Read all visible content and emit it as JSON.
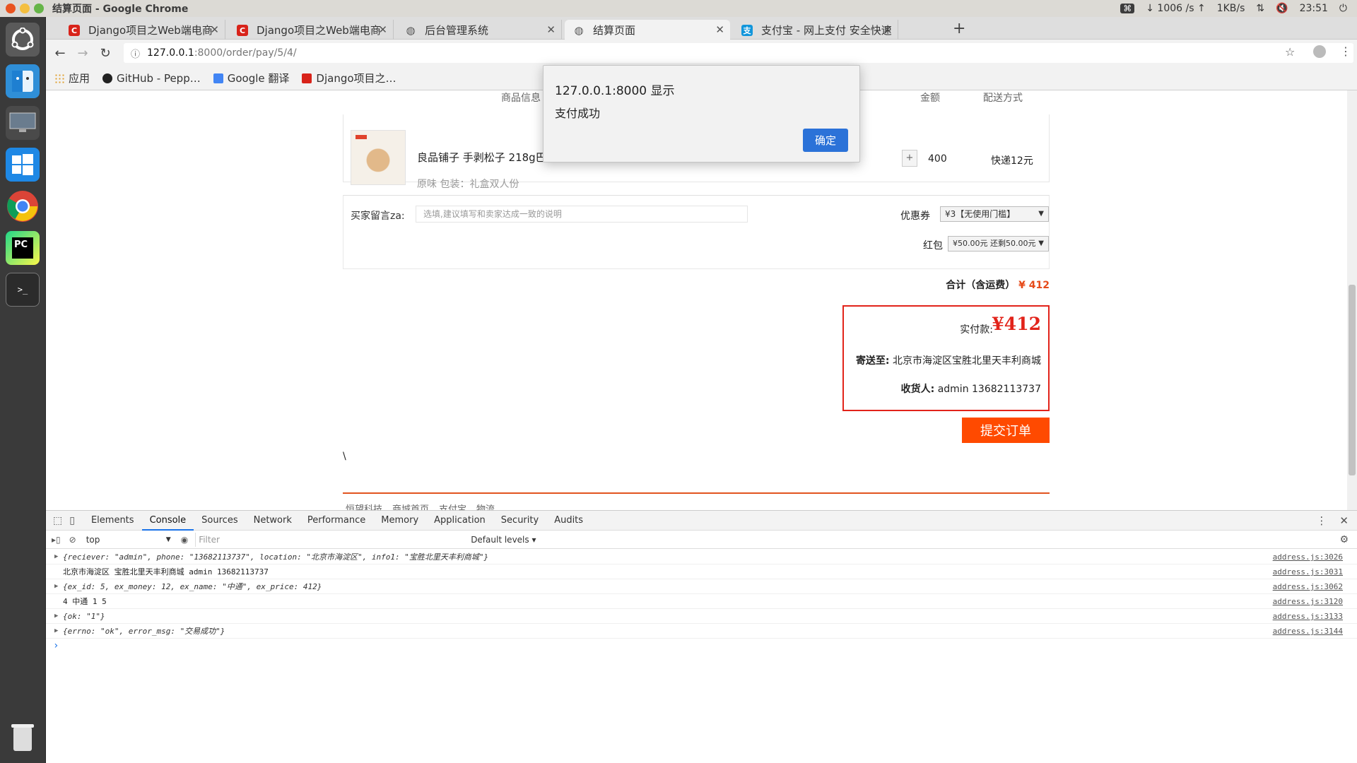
{
  "window": {
    "title": "结算页面 - Google Chrome"
  },
  "tray": {
    "key_icon": "⌘",
    "download": "↓ 1006 /s ↑",
    "upload": "1KB/s",
    "time": "23:51"
  },
  "tabs": [
    {
      "label": "Django项目之Web端电商",
      "favicon": "C",
      "color": "#d8231a"
    },
    {
      "label": "Django项目之Web端电商",
      "favicon": "C",
      "color": "#d8231a"
    },
    {
      "label": "后台管理系统",
      "favicon": "◍",
      "color": "#555555"
    },
    {
      "label": "结算页面",
      "favicon": "◍",
      "color": "#555555"
    },
    {
      "label": "支付宝 - 网上支付 安全快速",
      "favicon": "支",
      "color": "#1296db"
    }
  ],
  "omnibox": {
    "host": "127.0.0.1",
    "path": ":8000/order/pay/5/4/"
  },
  "bookmarks": [
    {
      "label": "应用",
      "color": "#e0a030"
    },
    {
      "label": "GitHub - Pepp…",
      "color": "#222222"
    },
    {
      "label": "Google 翻译",
      "color": "#4285f4"
    },
    {
      "label": "Django项目之…",
      "color": "#d8231a"
    }
  ],
  "order": {
    "headers": {
      "goods": "商品信息",
      "amount": "金额",
      "shipping": "配送方式"
    },
    "item": {
      "name": "良品铺子 手剥松子 218g巴西",
      "spec": "原味 包装：礼盒双人份",
      "price": "400",
      "shipping": "快递12元",
      "qty_plus": "+"
    },
    "note_label": "买家留言za:",
    "note_placeholder": "选填,建议填写和卖家达成一致的说明",
    "coupon_label": "优惠券",
    "coupon_value": "¥3【无使用门槛】",
    "redpack_label": "红包",
    "redpack_value": "¥50.00元 还剩50.00元",
    "total_label": "合计（含运费）",
    "total_amount": "¥ 412",
    "pay_label": "实付款:",
    "pay_amount": "¥412",
    "ship_label": "寄送至:",
    "ship_address": "北京市海淀区宝胜北里天丰利商城",
    "receiver_label": "收货人:",
    "receiver": "admin 13682113737",
    "submit": "提交订单",
    "backslash": "\\",
    "footer_links": [
      "恒望科技",
      "商城首页",
      "支付宝",
      "物流"
    ]
  },
  "alert": {
    "title": "127.0.0.1:8000 显示",
    "message": "支付成功",
    "ok": "确定"
  },
  "devtools": {
    "tabs": [
      "Elements",
      "Console",
      "Sources",
      "Network",
      "Performance",
      "Memory",
      "Application",
      "Security",
      "Audits"
    ],
    "active_tab": "Console",
    "context": "top",
    "filter_placeholder": "Filter",
    "levels": "Default levels",
    "logs": [
      {
        "html_key": "l1",
        "src": "address.js:3026"
      },
      {
        "html_key": "l2",
        "src": "address.js:3031"
      },
      {
        "html_key": "l3",
        "src": "address.js:3062"
      },
      {
        "html_key": "l4",
        "src": "address.js:3120"
      },
      {
        "html_key": "l5",
        "src": "address.js:3133"
      },
      {
        "html_key": "l6",
        "src": "address.js:3144"
      }
    ],
    "log_text": {
      "l1": "{reciever: \"admin\", phone: \"13682113737\", location: \"北京市海淀区\", info1: \"宝胜北里天丰利商城\"}",
      "l2": "北京市海淀区 宝胜北里天丰利商城 admin 13682113737",
      "l3": "{ex_id: 5, ex_money: 12, ex_name: \"中通\", ex_price: 412}",
      "l4": "4 中通 1 5",
      "l5": "{ok: \"1\"}",
      "l6": "{errno: \"ok\", error_msg: \"交易成功\"}"
    },
    "prompt": "›"
  }
}
